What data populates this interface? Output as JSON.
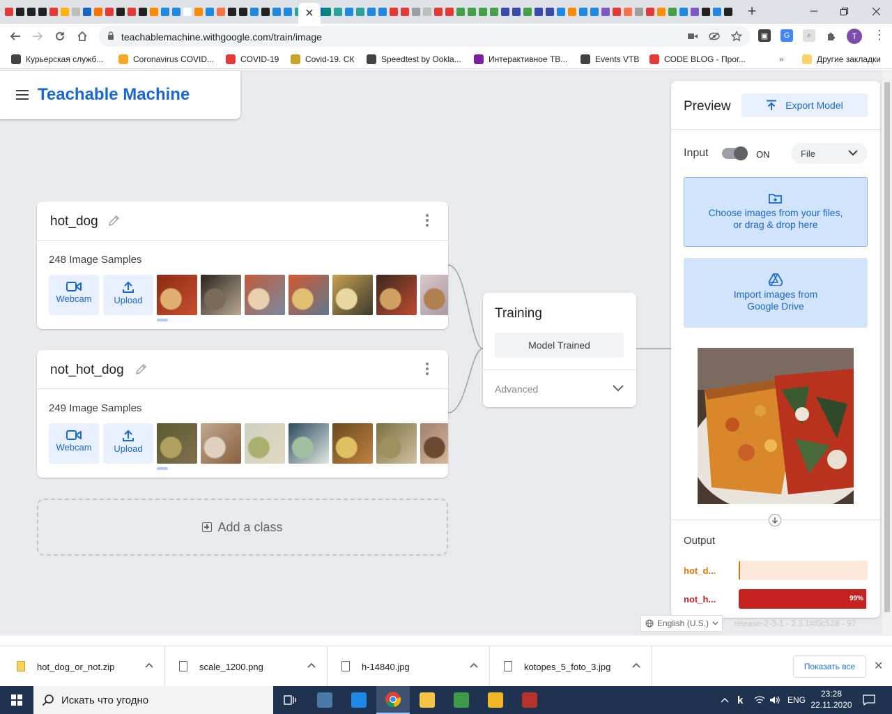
{
  "browser": {
    "url": "teachablemachine.withgoogle.com/train/image",
    "avatar_letter": "T",
    "tab_colors_left": [
      "#e53935",
      "#212121",
      "#212121",
      "#212121",
      "#e53935",
      "#ffb300",
      "#bdbdbd",
      "#1565c0",
      "#ff6f00",
      "#e53935",
      "#212121",
      "#e53935",
      "#212121",
      "#fb8c00",
      "#1e88e5",
      "#1e88e5",
      "#ffffff",
      "#fb8c00",
      "#1e88e5",
      "#ff7043",
      "#212121",
      "#212121",
      "#1e88e5",
      "#212121",
      "#1e88e5",
      "#1e88e5",
      "#26a69a",
      "#5e35b1",
      "#1565c0"
    ],
    "tab_colors_right": [
      "#00897b",
      "#26a69a",
      "#1e88e5",
      "#26a69a",
      "#1e88e5",
      "#1e88e5",
      "#e53935",
      "#e53935",
      "#9e9e9e",
      "#bdbdbd",
      "#e53935",
      "#e53935",
      "#43a047",
      "#43a047",
      "#43a047",
      "#43a047",
      "#3949ab",
      "#3949ab",
      "#43a047",
      "#3949ab",
      "#3949ab",
      "#1e88e5",
      "#fb8c00",
      "#1e88e5",
      "#1e88e5",
      "#7e57c2",
      "#e53935",
      "#ff7043",
      "#9e9e9e",
      "#e53935",
      "#ff8f00",
      "#43a047",
      "#1e88e5",
      "#7e57c2",
      "#212121",
      "#1e88e5",
      "#212121"
    ]
  },
  "bookmarks": [
    {
      "label": "Курьерская служб...",
      "color": "#424242"
    },
    {
      "label": "Coronavirus COVID...",
      "color": "#f9a825"
    },
    {
      "label": "COVID-19",
      "color": "#e53935"
    },
    {
      "label": "Covid-19. СК",
      "color": "#c9a227"
    },
    {
      "label": "Speedtest by Ookla...",
      "color": "#424242"
    },
    {
      "label": "Интерактивное ТВ...",
      "color": "#7b1fa2"
    },
    {
      "label": "Events VTB",
      "color": "#424242"
    },
    {
      "label": "CODE BLOG - Прог...",
      "color": "#e53935"
    }
  ],
  "bookmarks_other": "Другие закладки",
  "app": {
    "title": "Teachable Machine"
  },
  "classes": [
    {
      "name": "hot_dog",
      "samples": "248 Image Samples",
      "webcam": "Webcam",
      "upload": "Upload",
      "thumbs": [
        [
          "#8a2a14",
          "#e0b070",
          "#c85030"
        ],
        [
          "#2a2420",
          "#7a6a58",
          "#b8a890"
        ],
        [
          "#c05a3a",
          "#e8d0b0",
          "#7a8aa0"
        ],
        [
          "#d05a30",
          "#e0c070",
          "#607890"
        ],
        [
          "#c8a050",
          "#e8d8a0",
          "#3a3a30"
        ],
        [
          "#3a2a20",
          "#d0a060",
          "#c04a30"
        ],
        [
          "#d8c8c8",
          "#b08050",
          "#a090a0"
        ],
        [
          "#3a2a20",
          "#e0d0b0",
          "#c09060"
        ]
      ]
    },
    {
      "name": "not_hot_dog",
      "samples": "249 Image Samples",
      "webcam": "Webcam",
      "upload": "Upload",
      "thumbs": [
        [
          "#5a5a30",
          "#b0a060",
          "#807050"
        ],
        [
          "#c0a890",
          "#e0d0c0",
          "#8a6040"
        ],
        [
          "#d0d0c0",
          "#a8b070",
          "#e0d8c0"
        ],
        [
          "#2a4a60",
          "#a0c0a0",
          "#e0e8e0"
        ],
        [
          "#6a4a20",
          "#e0c060",
          "#c08040"
        ],
        [
          "#7a7040",
          "#a09060",
          "#d0c0a0"
        ],
        [
          "#a08070",
          "#6a4a30",
          "#e0c0a0"
        ]
      ]
    }
  ],
  "add_class": "Add a class",
  "training": {
    "title": "Training",
    "status": "Model Trained",
    "advanced": "Advanced"
  },
  "preview": {
    "title": "Preview",
    "export": "Export Model",
    "input_label": "Input",
    "toggle_state": "ON",
    "source": "File",
    "drop_text_1": "Choose images from your files,",
    "drop_text_2": "or drag & drop here",
    "drive_text_1": "Import images from",
    "drive_text_2": "Google Drive",
    "output_label": "Output",
    "outputs": [
      {
        "label": "hot_d...",
        "color": "#e37400",
        "track": "#fde9dc",
        "value": 0.01,
        "pct_label": ""
      },
      {
        "label": "not_h...",
        "color": "#c5221f",
        "track": "#fce4ec",
        "value": 0.99,
        "pct_label": "99%"
      }
    ]
  },
  "footer": {
    "language": "English (U.S.)",
    "release": "release-2-3-1 - 2.3.1#f0c528 - 97"
  },
  "downloads": [
    {
      "name": "hot_dog_or_not.zip"
    },
    {
      "name": "scale_1200.png"
    },
    {
      "name": "h-14840.jpg"
    },
    {
      "name": "kotopes_5_foto_3.jpg"
    }
  ],
  "downloads_show_all": "Показать все",
  "taskbar": {
    "search_placeholder": "Искать что угодно",
    "lang": "ENG",
    "time": "23:28",
    "date": "22.11.2020"
  }
}
